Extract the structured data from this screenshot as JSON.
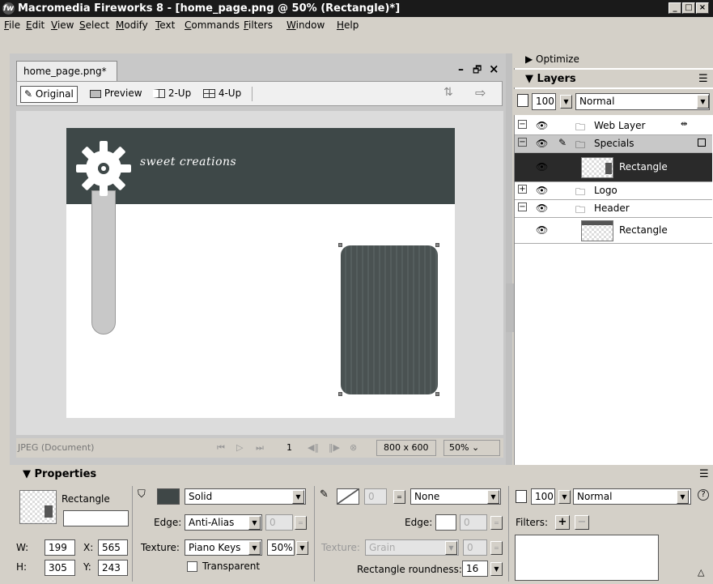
{
  "window": {
    "title": "Macromedia Fireworks 8 - [home_page.png @ 50% (Rectangle)*]",
    "app_icon": "fw",
    "min_btn": "_",
    "max_btn": "□",
    "close_btn": "×"
  },
  "menu": [
    "File",
    "Edit",
    "View",
    "Select",
    "Modify",
    "Text",
    "Commands",
    "Filters",
    "Window",
    "Help"
  ],
  "document": {
    "tab_label": "home_page.png*",
    "ctrl_min": "–",
    "ctrl_restore": "🗗",
    "ctrl_close": "×",
    "views": {
      "original": "Original",
      "preview": "Preview",
      "two_up": "2-Up",
      "four_up": "4-Up"
    },
    "canvas_brand_text": "sweet creations",
    "status": {
      "format": "JPEG (Document)",
      "frame": "1",
      "size": "800 x 600",
      "zoom": "50%"
    }
  },
  "panels": {
    "optimize_label": "Optimize",
    "layers_label": "Layers",
    "opacity": "100",
    "blend_mode": "Normal",
    "layers": [
      {
        "name": "Web Layer",
        "type": "folder"
      },
      {
        "name": "Specials",
        "type": "folder",
        "selected": true
      },
      {
        "name": "Rectangle",
        "type": "object",
        "active": true
      },
      {
        "name": "Logo",
        "type": "folder"
      },
      {
        "name": "Header",
        "type": "folder"
      },
      {
        "name": "Rectangle",
        "type": "object"
      }
    ]
  },
  "properties": {
    "header": "Properties",
    "object_type": "Rectangle",
    "object_name": "",
    "w_label": "W:",
    "w": "199",
    "h_label": "H:",
    "h": "305",
    "x_label": "X:",
    "x": "565",
    "y_label": "Y:",
    "y": "243",
    "fill_type": "Solid",
    "fill_color": "#3f4747",
    "edge_label": "Edge:",
    "fill_edge": "Anti-Alias",
    "fill_edge_value": "0",
    "texture_label": "Texture:",
    "fill_texture": "Piano Keys",
    "fill_texture_amount": "50%",
    "transparent_label": "Transparent",
    "stroke_size": "0",
    "stroke_type": "None",
    "stroke_edge_value": "0",
    "stroke_texture": "Grain",
    "stroke_texture_amount": "0",
    "roundness_label": "Rectangle roundness:",
    "roundness": "16",
    "opacity": "100",
    "blend_mode": "Normal",
    "filters_label": "Filters:",
    "help_icon": "?"
  }
}
